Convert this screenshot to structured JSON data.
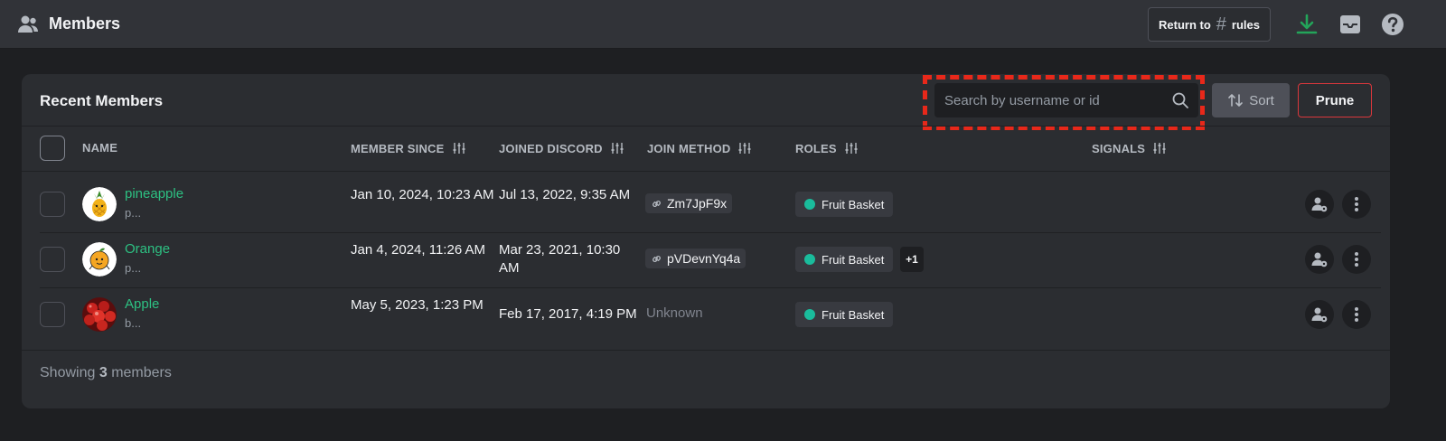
{
  "header": {
    "title": "Members",
    "return_label": "Return to",
    "channel_hash": "#",
    "channel_name": "rules"
  },
  "card": {
    "title": "Recent Members",
    "search_placeholder": "Search by username or id",
    "sort_label": "Sort",
    "prune_label": "Prune"
  },
  "columns": {
    "name": "NAME",
    "member_since": "MEMBER SINCE",
    "joined_discord": "JOINED DISCORD",
    "join_method": "JOIN METHOD",
    "roles": "ROLES",
    "signals": "SIGNALS"
  },
  "members": [
    {
      "name": "pineapple",
      "sub": "p...",
      "member_since": "Jan 10, 2024, 10:23 AM",
      "joined_discord": "Jul 13, 2022, 9:35 AM",
      "join_method": "Zm7JpF9x",
      "role": "Fruit Basket",
      "extra_roles": ""
    },
    {
      "name": "Orange",
      "sub": "p...",
      "member_since": "Jan 4, 2024, 11:26 AM",
      "joined_discord": "Mar 23, 2021, 10:30 AM",
      "join_method": "pVDevnYq4a",
      "role": "Fruit Basket",
      "extra_roles": "+1"
    },
    {
      "name": "Apple",
      "sub": "b...",
      "member_since": "May 5, 2023, 1:23 PM",
      "joined_discord": "Feb 17, 2017, 4:19 PM",
      "join_method": "Unknown",
      "role": "Fruit Basket",
      "extra_roles": ""
    }
  ],
  "footer": {
    "prefix": "Showing",
    "count": "3",
    "suffix": "members"
  },
  "colors": {
    "accent_green": "#2dc082",
    "role_color": "#1abc9c",
    "danger": "#da373c",
    "highlight": "#e8281a"
  }
}
